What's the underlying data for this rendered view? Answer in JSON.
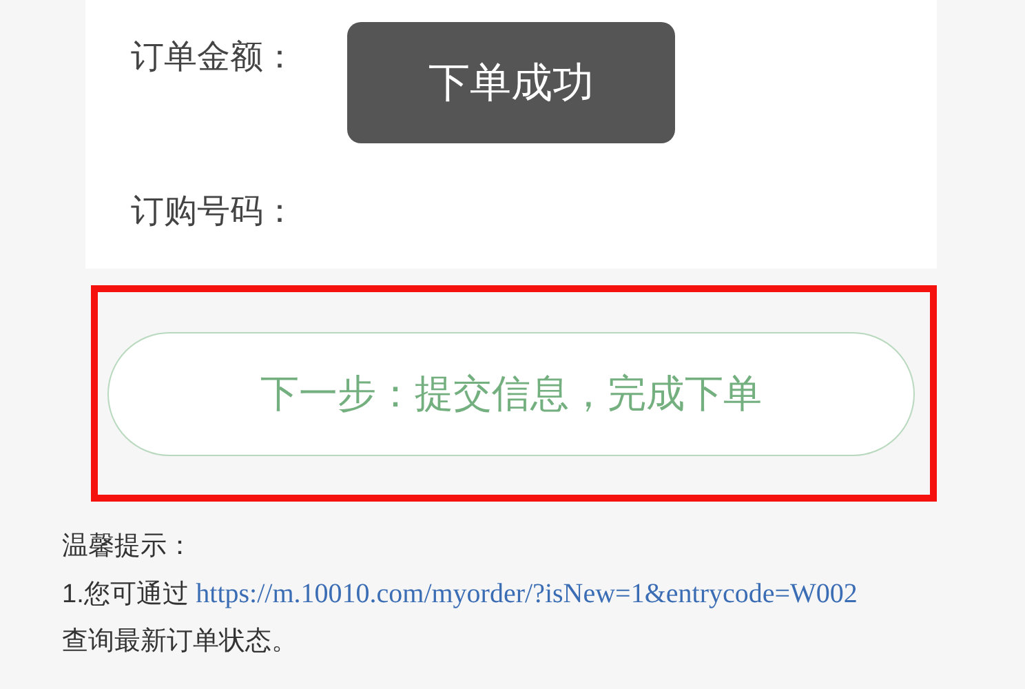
{
  "order_fields": [
    {
      "label": "订单金额："
    },
    {
      "label": "订购号码："
    }
  ],
  "toast": {
    "text": "下单成功"
  },
  "next_button": {
    "label": "下一步：提交信息，完成下单",
    "highlighted": true
  },
  "tips": {
    "title": "温馨提示：",
    "line_prefix": "1.您可通过",
    "link": "https://m.10010.com/myorder/?isNew=1&entrycode=W002",
    "line_suffix": "查询最新订单状态。"
  }
}
